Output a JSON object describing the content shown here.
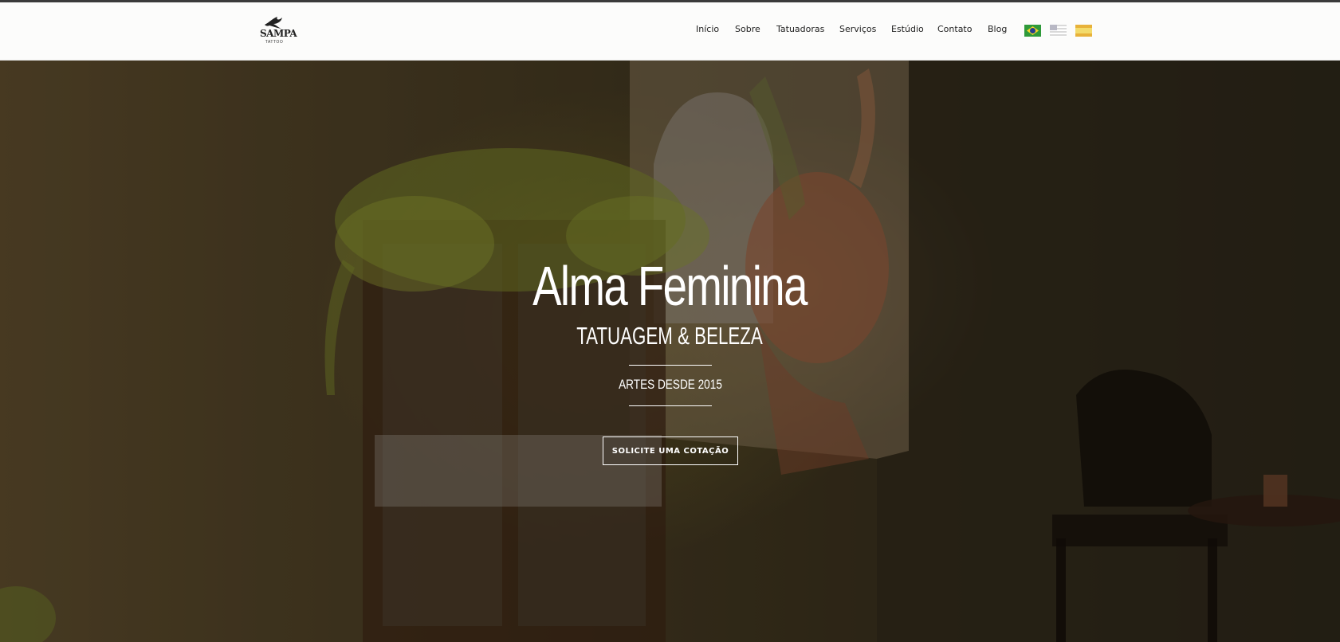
{
  "brand": {
    "logo_text": "SAMPA",
    "logo_subtext": "TATTOO"
  },
  "nav": {
    "items": [
      {
        "label": "Início"
      },
      {
        "label": "Sobre"
      },
      {
        "label": "Tatuadoras"
      },
      {
        "label": "Serviços"
      },
      {
        "label": "Estúdio"
      },
      {
        "label": "Contato"
      },
      {
        "label": "Blog"
      }
    ],
    "languages": [
      {
        "icon": "flag-brazil-icon"
      },
      {
        "icon": "flag-usa-icon"
      },
      {
        "icon": "flag-spain-icon"
      }
    ]
  },
  "hero": {
    "title": "Alma Feminina",
    "subtitle": "TATUAGEM & BELEZA",
    "since": "ARTES DESDE 2015",
    "cta_label": "SOLICITE UMA COTAÇÃO"
  },
  "colors": {
    "header_bg": "#fcfcfb",
    "nav_text": "#222222",
    "hero_text": "#ffffff"
  }
}
